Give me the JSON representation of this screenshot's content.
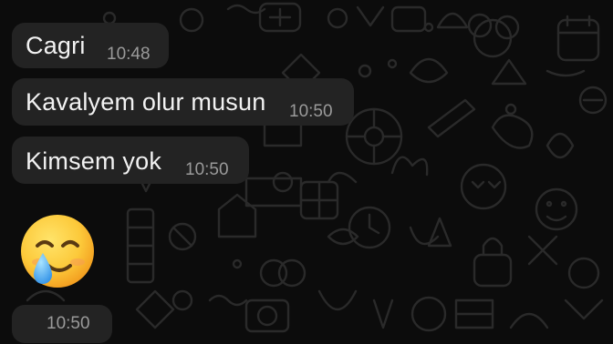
{
  "chat": {
    "background_color": "#0c0c0c",
    "bubble_color": "#232323",
    "text_color": "#f2f2f2",
    "time_color": "#9a9a9a",
    "messages": [
      {
        "text": "Cagri",
        "time": "10:48"
      },
      {
        "text": "Kavalyem olur musun",
        "time": "10:50"
      },
      {
        "text": "Kimsem yok",
        "time": "10:50"
      },
      {
        "emoji": "smiling-face-with-tear-emoji",
        "time": "10:50"
      }
    ]
  }
}
